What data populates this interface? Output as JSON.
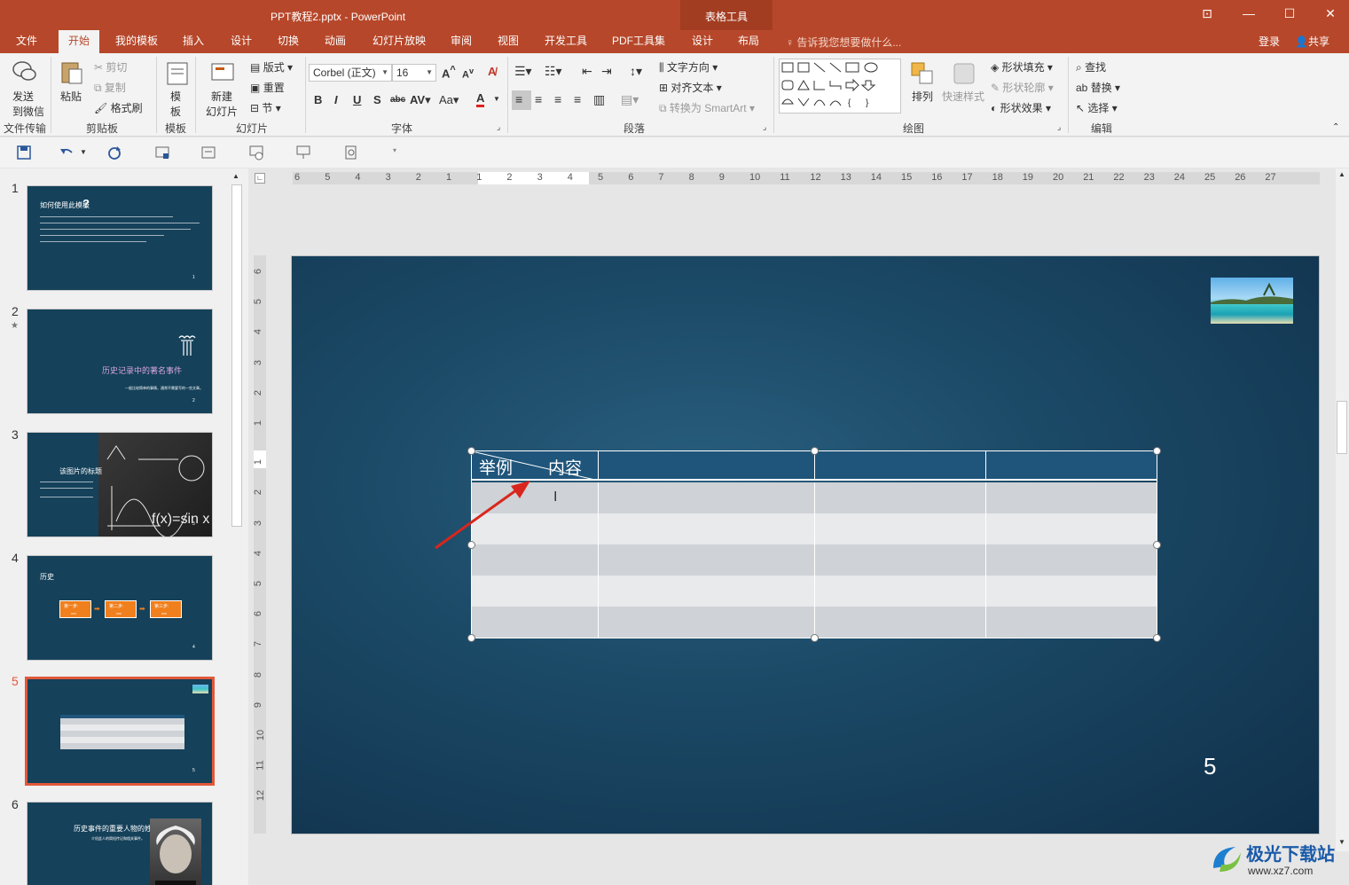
{
  "window": {
    "title": "PPT教程2.pptx - PowerPoint",
    "context_tools": "表格工具"
  },
  "tabs": [
    "文件",
    "开始",
    "我的模板",
    "插入",
    "设计",
    "切换",
    "动画",
    "幻灯片放映",
    "审阅",
    "视图",
    "开发工具",
    "PDF工具集",
    "设计",
    "布局"
  ],
  "tell_me": "告诉我您想要做什么...",
  "account": {
    "login": "登录",
    "share": "共享"
  },
  "ribbon": {
    "groups": {
      "file_transfer": "文件传输",
      "clipboard": "剪贴板",
      "template": "模板",
      "slides": "幻灯片",
      "font": "字体",
      "paragraph": "段落",
      "drawing": "绘图",
      "editing": "编辑"
    },
    "send_wechat_1": "发送",
    "send_wechat_2": "到微信",
    "paste": "粘贴",
    "cut": "剪切",
    "copy": "复制",
    "format_painter": "格式刷",
    "template_1": "模",
    "template_2": "板",
    "new_slide_1": "新建",
    "new_slide_2": "幻灯片",
    "layout": "版式",
    "reset": "重置",
    "section": "节",
    "font_name": "Corbel (正文)",
    "font_size": "16",
    "text_direction": "文字方向",
    "align_text": "对齐文本",
    "convert_smartart": "转换为 SmartArt",
    "arrange": "排列",
    "quick_styles": "快速样式",
    "shape_fill": "形状填充",
    "shape_outline": "形状轮廓",
    "shape_effects": "形状效果",
    "find": "查找",
    "replace": "替换",
    "select": "选择"
  },
  "thumbnails": [
    {
      "num": "1",
      "title": "如何使用此模板",
      "mark": "?",
      "page": "1"
    },
    {
      "num": "2",
      "star": "★",
      "title": "历史记录中的著名事件",
      "sub": "一般比较简单的事情，通常不需要写的一些文章。",
      "page": "2"
    },
    {
      "num": "3",
      "title": "该图片的标题",
      "page": "3"
    },
    {
      "num": "4",
      "title": "历史",
      "steps": [
        "第一步:",
        "第二步:",
        "第三步:"
      ],
      "step_sub": "xxx",
      "page": "4"
    },
    {
      "num": "5",
      "page": "5"
    },
    {
      "num": "6",
      "title": "历史事件的重要人物的姓名",
      "sub": "介绍此人的简短传记和相关事件。"
    }
  ],
  "slide": {
    "number": "5",
    "table": {
      "header_left": "举例",
      "header_right": "内容"
    }
  },
  "watermark": {
    "title": "极光下载站",
    "url": "www.xz7.com"
  },
  "colors": {
    "accent": "#b7472a",
    "table_header": "#1f557b",
    "table_row_dark": "#cfd2d6",
    "table_row_light": "#e8eaec",
    "arrow": "#d9261c",
    "selection": "#e1583a"
  }
}
